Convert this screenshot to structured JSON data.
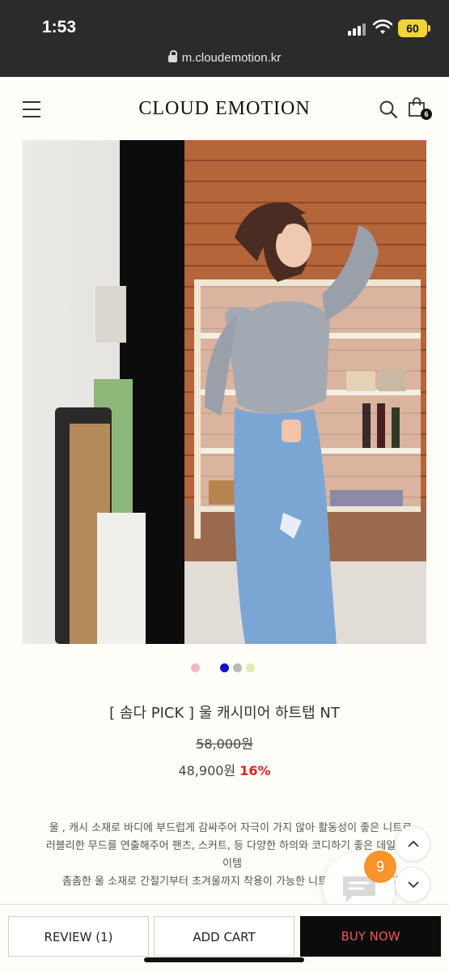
{
  "status_bar": {
    "time": "1:53",
    "battery": "60"
  },
  "browser": {
    "url": "m.cloudemotion.kr"
  },
  "header": {
    "logo": "CLOUD EMOTION",
    "cart_count": "6"
  },
  "gallery": {
    "slide_count": 4,
    "active_slide": 1
  },
  "color_options": [
    "#f4b6c9",
    "#1111cc",
    "#b9b9b9",
    "#dfeab0"
  ],
  "product": {
    "title": "[ 솜다 PICK ] 울 캐시미어 하트탭 NT",
    "original_price": "58,000원",
    "sale_price": "48,900원",
    "discount": "16%"
  },
  "description": [
    "울 , 캐시 소재로 바디에 부드럽게 감싸주어 자극이 가지 않아 활동성이 좋은 니트로,",
    "러블리한 무드를 연출해주어 팬츠, 스커트, 등 다양한 하의와 코디하기 좋은 데일리 아이템",
    "촘촘한 울 소재로 간절기부터 초겨울까지 착용이 가능한 니트로 추천드립니다."
  ],
  "chat": {
    "badge_count": "9"
  },
  "actions": {
    "review": "REVIEW (1)",
    "add_cart": "ADD CART",
    "buy_now": "BUY NOW"
  },
  "colors": {
    "accent_red": "#e02222",
    "badge_orange": "#f7942a",
    "buy_text": "#e8595a"
  }
}
